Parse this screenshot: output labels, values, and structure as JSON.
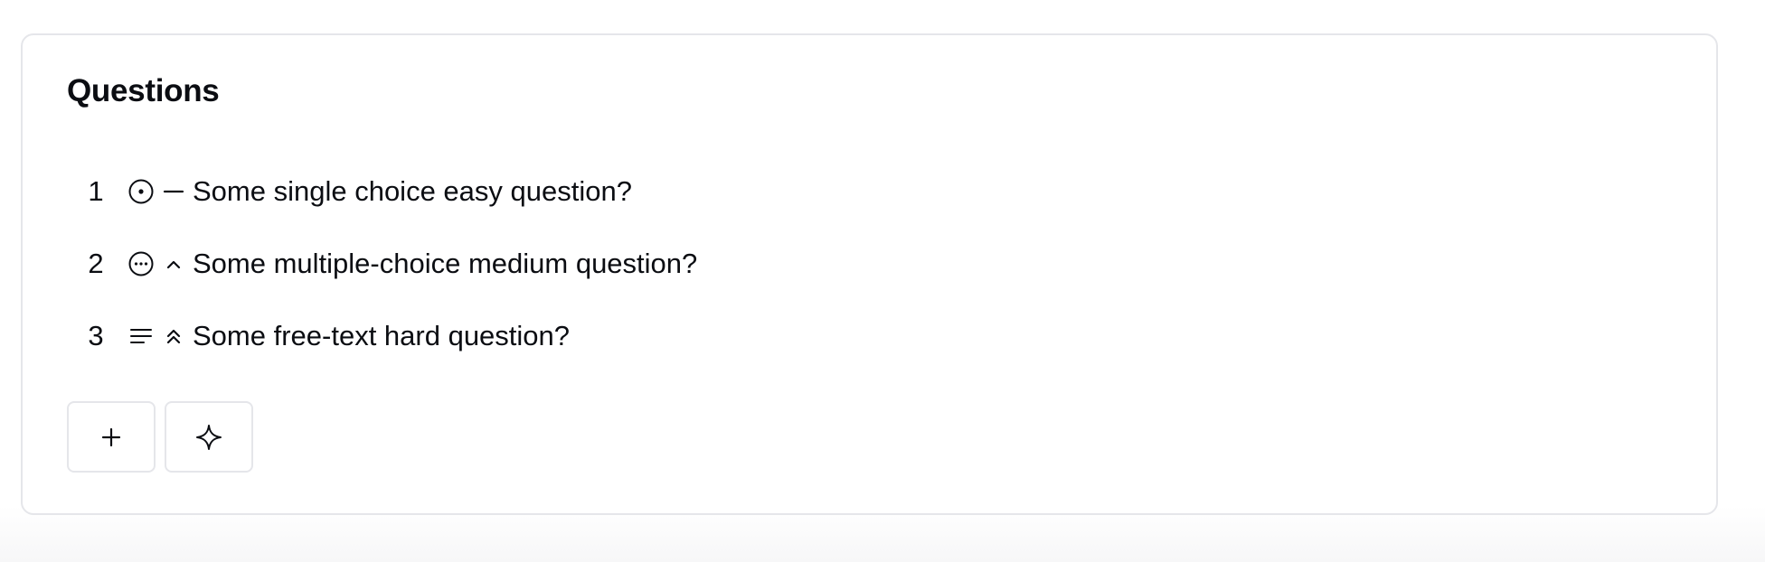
{
  "section": {
    "title": "Questions"
  },
  "questions": [
    {
      "number": "1",
      "type_icon": "radio-circle-icon",
      "difficulty_icon": "dash-icon",
      "text": "Some single choice easy question?"
    },
    {
      "number": "2",
      "type_icon": "ellipsis-circle-icon",
      "difficulty_icon": "chevron-up-icon",
      "text": "Some multiple-choice medium question?"
    },
    {
      "number": "3",
      "type_icon": "text-lines-icon",
      "difficulty_icon": "double-chevron-up-icon",
      "text": "Some free-text hard question?"
    }
  ],
  "actions": {
    "add_icon": "plus-icon",
    "ai_icon": "sparkle-icon"
  }
}
